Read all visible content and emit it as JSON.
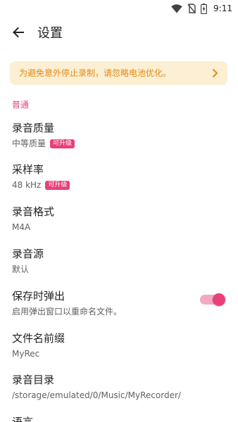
{
  "status_bar": {
    "time": "9:11",
    "icons": [
      "wifi-icon",
      "no-sim-icon",
      "battery-charging-icon"
    ]
  },
  "app_bar": {
    "back_icon": "arrow-back-icon",
    "title": "设置"
  },
  "banner": {
    "text": "为避免意外停止录制，请忽略电池优化。",
    "icon": "chevron-right-icon"
  },
  "section": {
    "general": "普通"
  },
  "prefs": {
    "quality": {
      "title": "录音质量",
      "summary": "中等质量",
      "badge": "可升级"
    },
    "sample_rate": {
      "title": "采样率",
      "summary": "48 kHz",
      "badge": "可升级"
    },
    "format": {
      "title": "录音格式",
      "summary": "M4A"
    },
    "source": {
      "title": "录音源",
      "summary": "默认"
    },
    "rename_popup": {
      "title": "保存时弹出",
      "summary": "启用弹出窗口以重命名文件。",
      "enabled": true
    },
    "filename_prefix": {
      "title": "文件名前缀",
      "summary": "MyRec"
    },
    "directory": {
      "title": "录音目录",
      "summary": "/storage/emulated/0/Music/MyRecorder/"
    },
    "language": {
      "title": "语言"
    }
  },
  "colors": {
    "accent": "#e9407a",
    "banner_bg": "#fcefd3",
    "banner_text": "#e38a11"
  }
}
